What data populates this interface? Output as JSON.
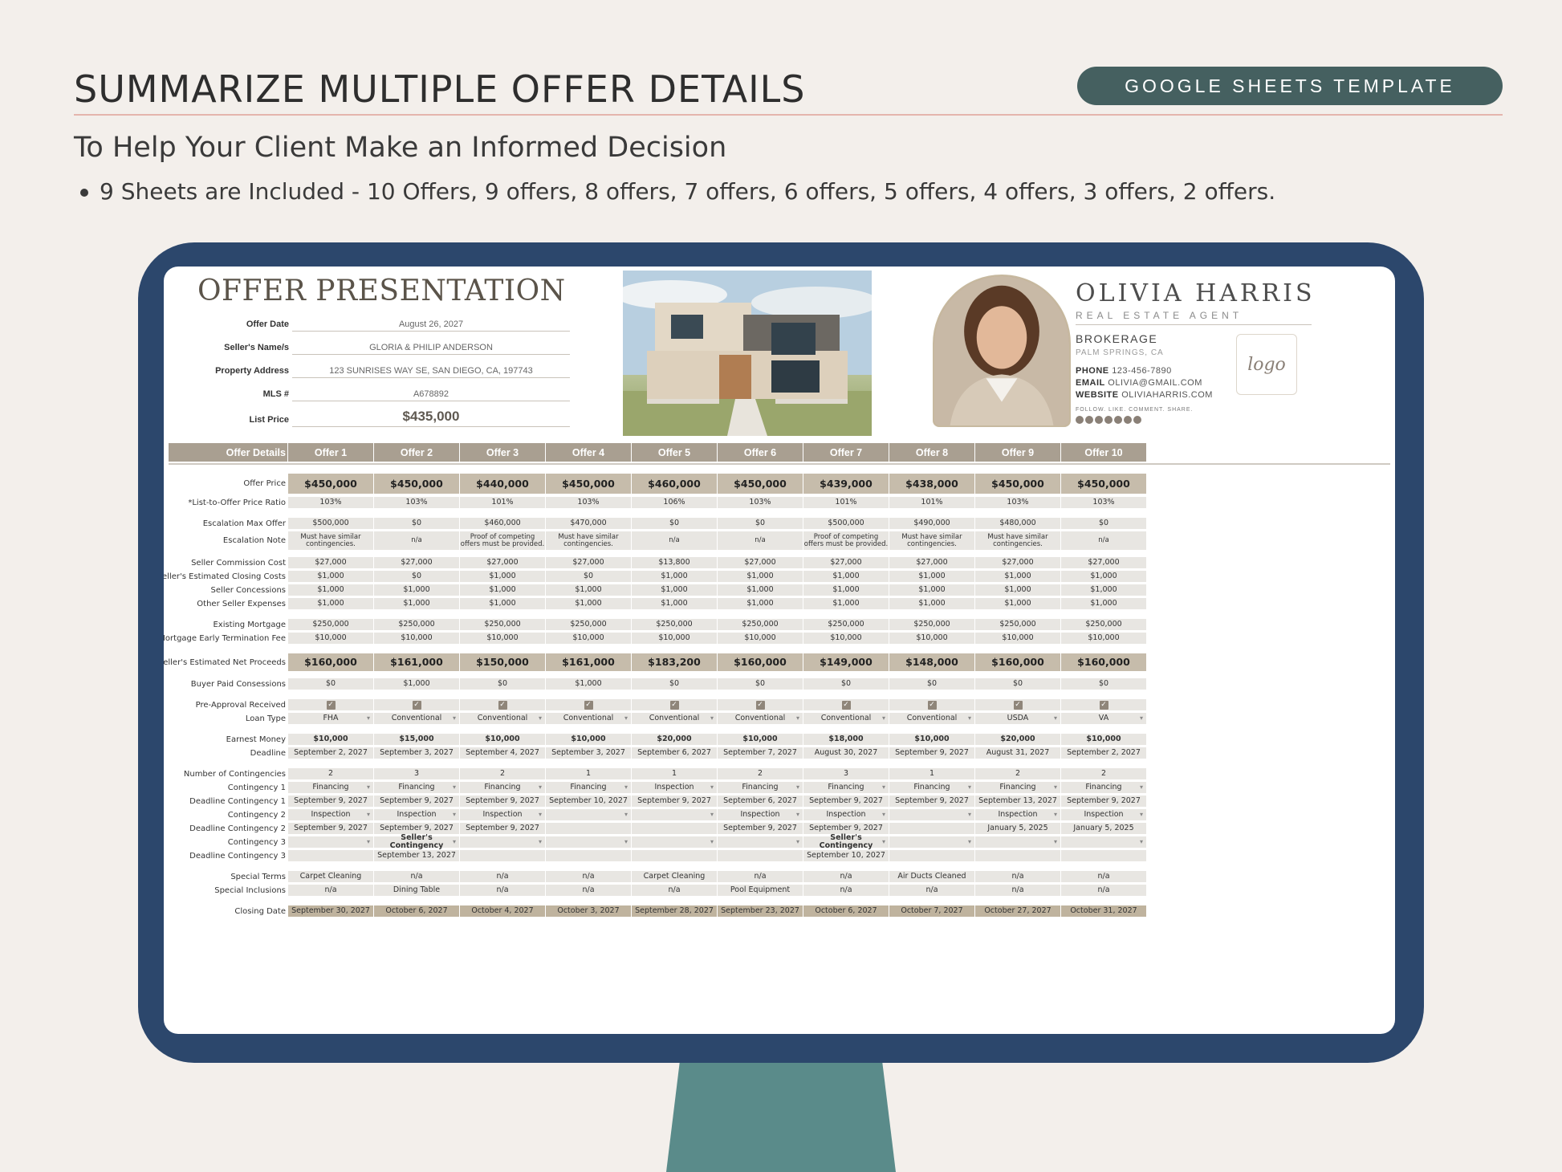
{
  "hero": {
    "title": "SUMMARIZE MULTIPLE OFFER DETAILS",
    "badge": "GOOGLE SHEETS TEMPLATE",
    "subtitle": "To Help Your Client Make an Informed Decision",
    "bullet": "9 Sheets are Included - 10 Offers, 9 offers, 8 offers, 7 offers, 6 offers, 5 offers, 4 offers, 3 offers, 2 offers."
  },
  "sheet": {
    "title": "OFFER PRESENTATION",
    "info": [
      {
        "label": "Offer Date",
        "value": "August 26, 2027"
      },
      {
        "label": "Seller's Name/s",
        "value": "GLORIA & PHILIP ANDERSON"
      },
      {
        "label": "Property Address",
        "value": "123 SUNRISES WAY SE, SAN DIEGO, CA, 197743"
      },
      {
        "label": "MLS #",
        "value": "A678892"
      },
      {
        "label": "List Price",
        "value": "$435,000"
      }
    ]
  },
  "agent": {
    "name": "OLIVIA HARRIS",
    "role": "REAL ESTATE AGENT",
    "brokerage": "BROKERAGE",
    "city": "PALM SPRINGS, CA",
    "phone_label": "PHONE",
    "phone": "123-456-7890",
    "email_label": "EMAIL",
    "email": "OLIVIA@GMAIL.COM",
    "website_label": "WEBSITE",
    "website": "OLIVIAHARRIS.COM",
    "follow": "FOLLOW. LIKE. COMMENT. SHARE.",
    "logo": "logo"
  },
  "table": {
    "headers": [
      "Offer Details",
      "Offer 1",
      "Offer 2",
      "Offer 3",
      "Offer 4",
      "Offer 5",
      "Offer 6",
      "Offer 7",
      "Offer 8",
      "Offer 9",
      "Offer 10"
    ],
    "rows": [
      {
        "label": "Offer Price",
        "style": "dark",
        "values": [
          "$450,000",
          "$450,000",
          "$440,000",
          "$450,000",
          "$460,000",
          "$450,000",
          "$439,000",
          "$438,000",
          "$450,000",
          "$450,000"
        ]
      },
      {
        "label": "*List-to-Offer Price Ratio",
        "values": [
          "103%",
          "103%",
          "101%",
          "103%",
          "106%",
          "103%",
          "101%",
          "101%",
          "103%",
          "103%"
        ]
      },
      {
        "label": "Escalation Max Offer",
        "values": [
          "$500,000",
          "$0",
          "$460,000",
          "$470,000",
          "$0",
          "$0",
          "$500,000",
          "$490,000",
          "$480,000",
          "$0"
        ]
      },
      {
        "label": "Escalation Note",
        "style": "sm",
        "values": [
          "Must have similar contingencies.",
          "n/a",
          "Proof of competing offers must be provided.",
          "Must have similar contingencies.",
          "n/a",
          "n/a",
          "Proof of competing offers must be provided.",
          "Must have similar contingencies.",
          "Must have similar contingencies.",
          "n/a"
        ]
      },
      {
        "label": "Seller Commission Cost",
        "values": [
          "$27,000",
          "$27,000",
          "$27,000",
          "$27,000",
          "$13,800",
          "$27,000",
          "$27,000",
          "$27,000",
          "$27,000",
          "$27,000"
        ]
      },
      {
        "label": "Seller's Estimated Closing Costs",
        "values": [
          "$1,000",
          "$0",
          "$1,000",
          "$0",
          "$1,000",
          "$1,000",
          "$1,000",
          "$1,000",
          "$1,000",
          "$1,000"
        ]
      },
      {
        "label": "Seller Concessions",
        "values": [
          "$1,000",
          "$1,000",
          "$1,000",
          "$1,000",
          "$1,000",
          "$1,000",
          "$1,000",
          "$1,000",
          "$1,000",
          "$1,000"
        ]
      },
      {
        "label": "Other Seller Expenses",
        "values": [
          "$1,000",
          "$1,000",
          "$1,000",
          "$1,000",
          "$1,000",
          "$1,000",
          "$1,000",
          "$1,000",
          "$1,000",
          "$1,000"
        ]
      },
      {
        "label": "Existing Mortgage",
        "values": [
          "$250,000",
          "$250,000",
          "$250,000",
          "$250,000",
          "$250,000",
          "$250,000",
          "$250,000",
          "$250,000",
          "$250,000",
          "$250,000"
        ]
      },
      {
        "label": "Mortgage Early Termination Fee",
        "values": [
          "$10,000",
          "$10,000",
          "$10,000",
          "$10,000",
          "$10,000",
          "$10,000",
          "$10,000",
          "$10,000",
          "$10,000",
          "$10,000"
        ]
      },
      {
        "label": "*Seller's Estimated Net Proceeds",
        "style": "dark",
        "values": [
          "$160,000",
          "$161,000",
          "$150,000",
          "$161,000",
          "$183,200",
          "$160,000",
          "$149,000",
          "$148,000",
          "$160,000",
          "$160,000"
        ]
      },
      {
        "label": "Buyer Paid Consessions",
        "values": [
          "$0",
          "$1,000",
          "$0",
          "$1,000",
          "$0",
          "$0",
          "$0",
          "$0",
          "$0",
          "$0"
        ]
      },
      {
        "label": "Pre-Approval Received",
        "style": "check",
        "values": [
          "",
          "",
          "",
          "",
          "",
          "",
          "",
          "",
          "",
          ""
        ]
      },
      {
        "label": "Loan Type",
        "style": "dd",
        "values": [
          "FHA",
          "Conventional",
          "Conventional",
          "Conventional",
          "Conventional",
          "Conventional",
          "Conventional",
          "Conventional",
          "USDA",
          "VA"
        ]
      },
      {
        "label": "Earnest Money",
        "style": "bold",
        "values": [
          "$10,000",
          "$15,000",
          "$10,000",
          "$10,000",
          "$20,000",
          "$10,000",
          "$18,000",
          "$10,000",
          "$20,000",
          "$10,000"
        ]
      },
      {
        "label": "Deadline",
        "values": [
          "September 2, 2027",
          "September 3, 2027",
          "September 4, 2027",
          "September 3, 2027",
          "September 6, 2027",
          "September 7, 2027",
          "August 30, 2027",
          "September 9, 2027",
          "August 31, 2027",
          "September 2, 2027"
        ]
      },
      {
        "label": "Number of Contingencies",
        "values": [
          "2",
          "3",
          "2",
          "1",
          "1",
          "2",
          "3",
          "1",
          "2",
          "2"
        ]
      },
      {
        "label": "Contingency 1",
        "style": "dd",
        "values": [
          "Financing",
          "Financing",
          "Financing",
          "Financing",
          "Inspection",
          "Financing",
          "Financing",
          "Financing",
          "Financing",
          "Financing"
        ]
      },
      {
        "label": "Deadline Contingency 1",
        "values": [
          "September 9, 2027",
          "September 9, 2027",
          "September 9, 2027",
          "September 10, 2027",
          "September 9, 2027",
          "September 6, 2027",
          "September 9, 2027",
          "September 9, 2027",
          "September 13, 2027",
          "September 9, 2027"
        ]
      },
      {
        "label": "Contingency 2",
        "style": "dd",
        "values": [
          "Inspection",
          "Inspection",
          "Inspection",
          "",
          "",
          "Inspection",
          "Inspection",
          "",
          "Inspection",
          "Inspection"
        ]
      },
      {
        "label": "Deadline Contingency 2",
        "values": [
          "September 9, 2027",
          "September 9, 2027",
          "September 9, 2027",
          "",
          "",
          "September 9, 2027",
          "September 9, 2027",
          "",
          "January 5, 2025",
          "January 5, 2025"
        ]
      },
      {
        "label": "Contingency 3",
        "style": "dd",
        "values": [
          "",
          "Seller's Contingency",
          "",
          "",
          "",
          "",
          "Seller's Contingency",
          "",
          "",
          ""
        ]
      },
      {
        "label": "Deadline Contingency 3",
        "values": [
          "",
          "September 13, 2027",
          "",
          "",
          "",
          "",
          "September 10, 2027",
          "",
          "",
          ""
        ]
      },
      {
        "label": "Special Terms",
        "values": [
          "Carpet Cleaning",
          "n/a",
          "n/a",
          "n/a",
          "Carpet Cleaning",
          "n/a",
          "n/a",
          "Air Ducts Cleaned",
          "n/a",
          "n/a"
        ]
      },
      {
        "label": "Special Inclusions",
        "values": [
          "n/a",
          "Dining Table",
          "n/a",
          "n/a",
          "n/a",
          "Pool Equipment",
          "n/a",
          "n/a",
          "n/a",
          "n/a"
        ]
      },
      {
        "label": "Closing Date",
        "style": "close",
        "values": [
          "September 30, 2027",
          "October 6, 2027",
          "October 4, 2027",
          "October 3, 2027",
          "September 28, 2027",
          "September 23, 2027",
          "October 6, 2027",
          "October 7, 2027",
          "October 27, 2027",
          "October 31, 2027"
        ]
      }
    ]
  }
}
